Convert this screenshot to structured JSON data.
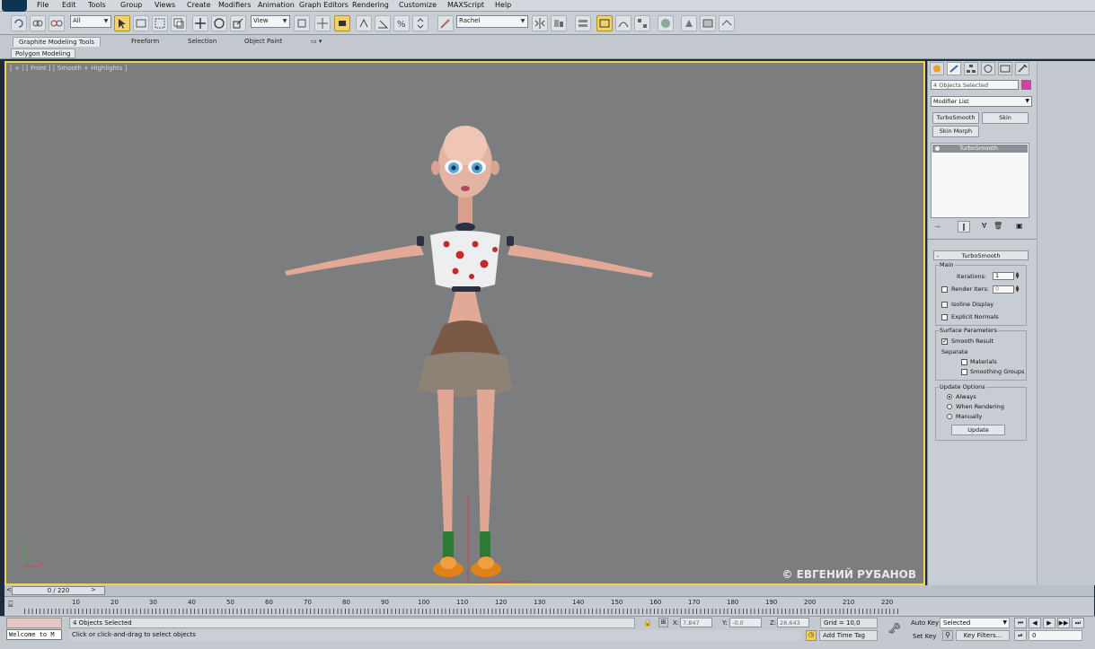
{
  "menu": {
    "items": [
      "File",
      "Edit",
      "Tools",
      "Group",
      "Views",
      "Create",
      "Modifiers",
      "Animation",
      "Graph Editors",
      "Rendering",
      "Customize",
      "MAXScript",
      "Help"
    ]
  },
  "toolbar": {
    "selection_filter": "All",
    "reference_coord": "View",
    "named_selection": "Rachel"
  },
  "ribbon": {
    "tabs": [
      "Graphite Modeling Tools",
      "Freeform",
      "Selection",
      "Object Paint"
    ],
    "sub_tab": "Polygon Modeling"
  },
  "viewport": {
    "label": "[ + ] [ Front ] [ Smooth + Highlights ]",
    "watermark": "© ЕВГЕНИЙ РУБАНОВ"
  },
  "command_panel": {
    "selection_name": "4 Objects Selected",
    "modifier_list": "Modifier List",
    "buttons": [
      "TurboSmooth",
      "Skin",
      "Skin Morph"
    ],
    "stack_item": "TurboSmooth",
    "accent_color": "#d040b0",
    "rollout": {
      "title": "TurboSmooth",
      "main_group": "Main",
      "iterations_label": "Iterations:",
      "iterations_value": "1",
      "render_iters_label": "Render Iters:",
      "render_iters_value": "0",
      "isoline_label": "Isoline Display",
      "explicit_normals_label": "Explicit Normals",
      "surface_group": "Surface Parameters",
      "smooth_result_label": "Smooth Result",
      "separate_label": "Separate",
      "materials_label": "Materials",
      "smoothing_groups_label": "Smoothing Groups",
      "update_group": "Update Options",
      "always_label": "Always",
      "when_rendering_label": "When Rendering",
      "manually_label": "Manually",
      "update_button": "Update"
    }
  },
  "timeline": {
    "frame_display": "0 / 220",
    "ticks": [
      "10",
      "20",
      "30",
      "40",
      "50",
      "60",
      "70",
      "80",
      "90",
      "100",
      "110",
      "120",
      "130",
      "140",
      "150",
      "160",
      "170",
      "180",
      "190",
      "200",
      "210",
      "220"
    ]
  },
  "status": {
    "listener": "Welcome to M",
    "selected_info": "4 Objects Selected",
    "prompt": "Click or click-and-drag to select objects",
    "x_label": "X:",
    "x_value": "7,847",
    "y_label": "Y:",
    "y_value": "-0,0",
    "z_label": "Z:",
    "z_value": "28,643",
    "grid": "Grid = 10,0",
    "add_time_tag": "Add Time Tag",
    "auto_key": "Auto Key",
    "set_key": "Set Key",
    "key_mode": "Selected",
    "key_filters": "Key Filters...",
    "current_frame": "0"
  }
}
